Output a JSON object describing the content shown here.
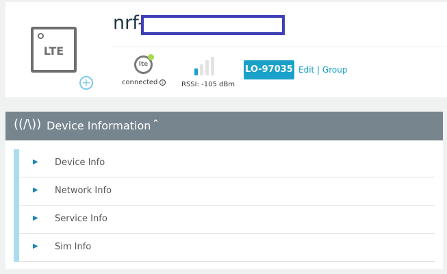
{
  "device": {
    "icon_label": "LTE",
    "name": "nrf-",
    "status": "connected",
    "rssi": "RSSI: -105 dBm",
    "signal_bars_filled": 1,
    "signal_bars_total": 4,
    "badge": "LO-97035",
    "edit_group": "Edit | Group",
    "lte_icon_text": "lte"
  },
  "section": {
    "title": "Device Information",
    "items": [
      {
        "label": "Device Info"
      },
      {
        "label": "Network Info"
      },
      {
        "label": "Service Info"
      },
      {
        "label": "Sim Info"
      }
    ]
  },
  "colors": {
    "accent": "#1aa1c9",
    "header": "#77858f",
    "status_dot": "#a8d84c"
  }
}
